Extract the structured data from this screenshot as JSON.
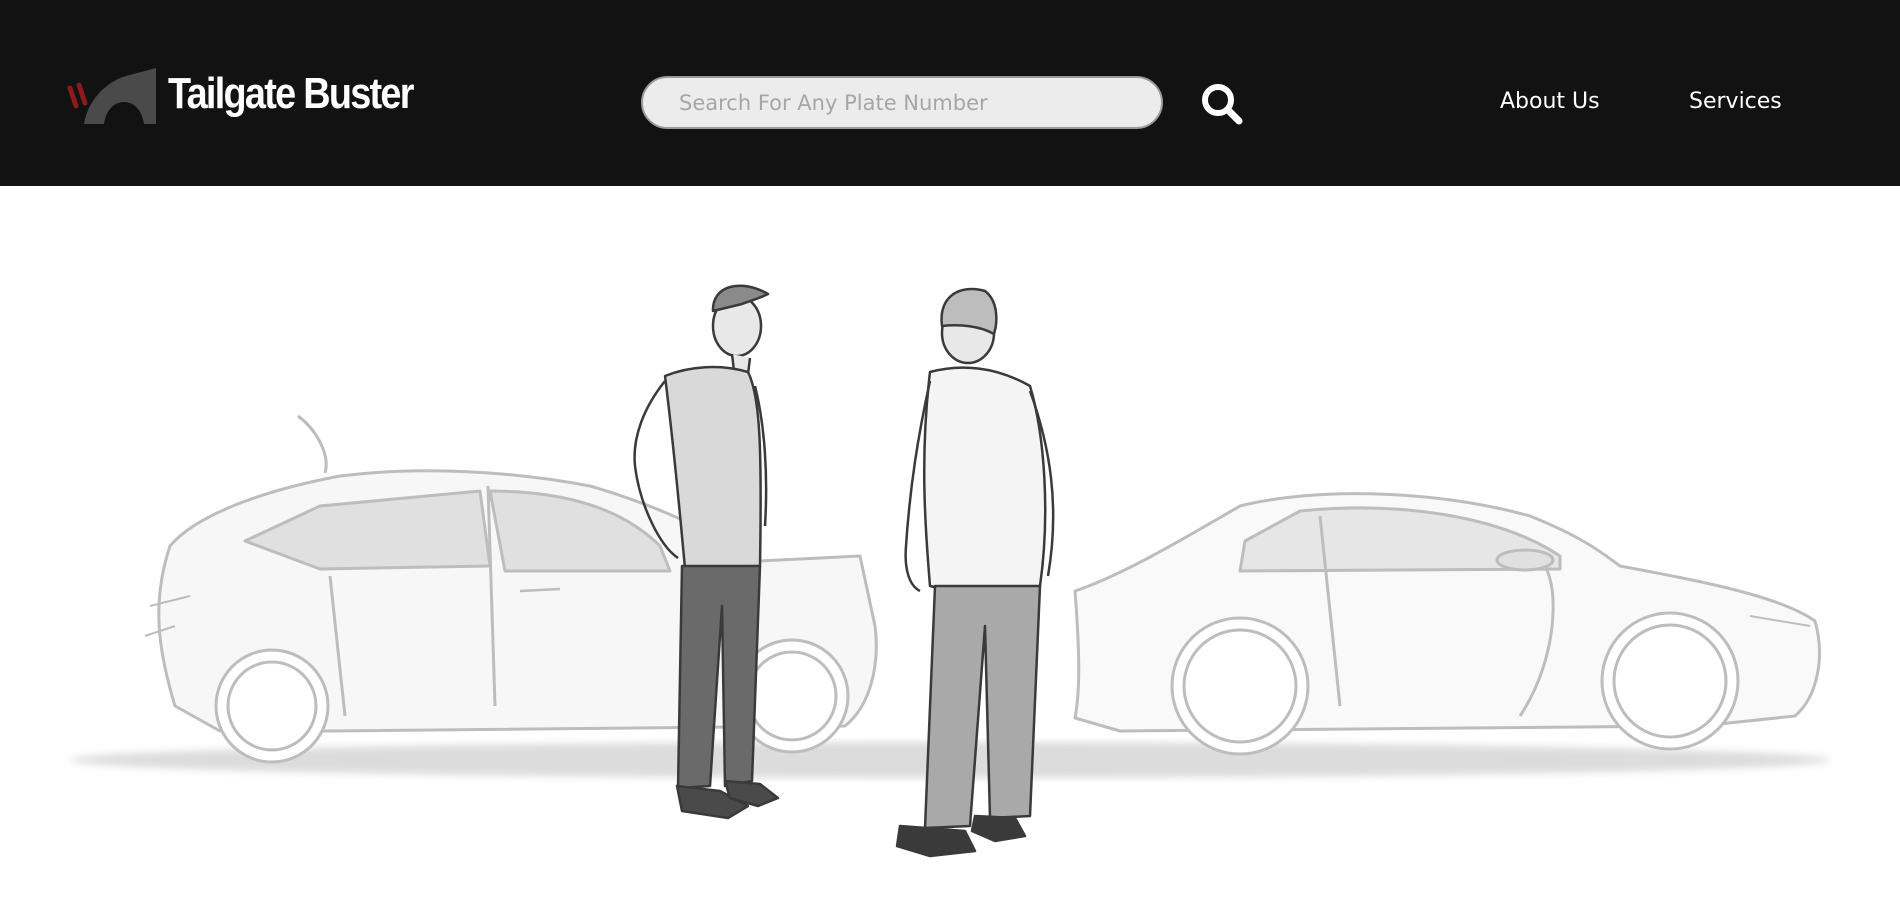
{
  "brand": {
    "name": "Tailgate Buster",
    "accent_color": "#8b1a1a",
    "mark_color": "#4a4a4a"
  },
  "header": {
    "background": "#121212"
  },
  "search": {
    "placeholder": "Search For Any Plate Number",
    "value": "",
    "icon": "search-icon"
  },
  "nav": {
    "items": [
      {
        "label": "About Us"
      },
      {
        "label": "Services"
      }
    ]
  },
  "hero": {
    "image": "sketch of two men standing between two cars after a rear-end collision"
  }
}
